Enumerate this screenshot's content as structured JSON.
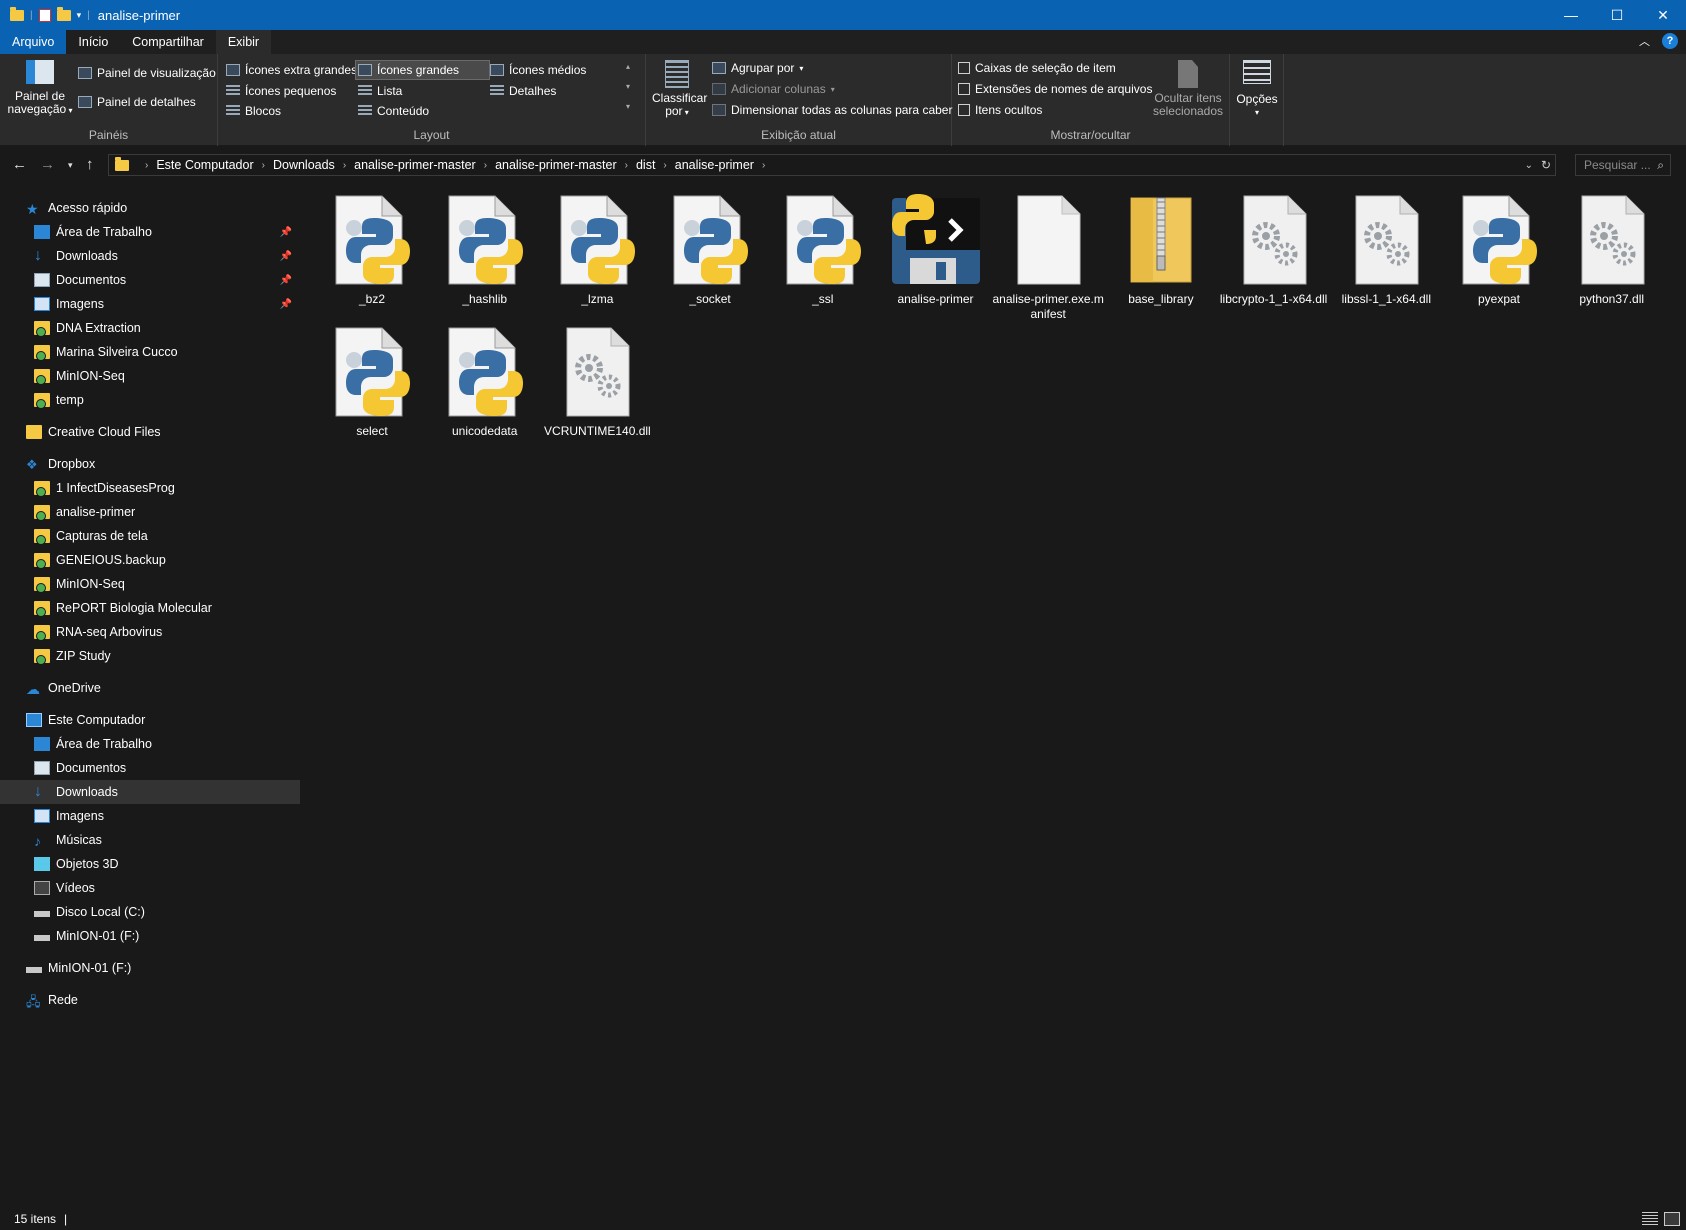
{
  "window": {
    "title": "analise-primer",
    "minimize": "—",
    "maximize": "☐",
    "close": "✕"
  },
  "menu": {
    "file": "Arquivo",
    "tabs": [
      "Início",
      "Compartilhar",
      "Exibir"
    ]
  },
  "ribbon": {
    "panes": {
      "nav_pane": "Painel de navegação",
      "preview_pane": "Painel de visualização",
      "details_pane": "Painel de detalhes",
      "label": "Painéis"
    },
    "layout": {
      "items": [
        "Ícones extra grandes",
        "Ícones grandes",
        "Ícones médios",
        "Ícones pequenos",
        "Lista",
        "Detalhes",
        "Blocos",
        "Conteúdo"
      ],
      "selected": "Ícones grandes",
      "label": "Layout"
    },
    "current_view": {
      "sort_by": "Classificar por",
      "group_by": "Agrupar por",
      "add_columns": "Adicionar colunas",
      "size_columns": "Dimensionar todas as colunas para caber",
      "label": "Exibição atual"
    },
    "show_hide": {
      "checkboxes": [
        "Caixas de seleção de item",
        "Extensões de nomes de arquivos",
        "Itens ocultos"
      ],
      "hide_selected": "Ocultar itens selecionados",
      "label": "Mostrar/ocultar"
    },
    "options": "Opções"
  },
  "address": {
    "crumbs": [
      "Este Computador",
      "Downloads",
      "analise-primer-master",
      "analise-primer-master",
      "dist",
      "analise-primer"
    ],
    "search_placeholder": "Pesquisar ..."
  },
  "sidebar": {
    "quick_access": "Acesso rápido",
    "quick_items": [
      {
        "label": "Área de Trabalho",
        "pinned": true
      },
      {
        "label": "Downloads",
        "pinned": true
      },
      {
        "label": "Documentos",
        "pinned": true
      },
      {
        "label": "Imagens",
        "pinned": true
      },
      {
        "label": "DNA Extraction",
        "pinned": false
      },
      {
        "label": "Marina Silveira Cucco",
        "pinned": false
      },
      {
        "label": "MinION-Seq",
        "pinned": false
      },
      {
        "label": "temp",
        "pinned": false
      }
    ],
    "creative_cloud": "Creative Cloud Files",
    "dropbox": "Dropbox",
    "dropbox_items": [
      "1 InfectDiseasesProg",
      "analise-primer",
      "Capturas de tela",
      "GENEIOUS.backup",
      "MinION-Seq",
      "RePORT Biologia Molecular",
      "RNA-seq Arbovirus",
      "ZIP Study"
    ],
    "onedrive": "OneDrive",
    "this_pc": "Este Computador",
    "pc_items": [
      "Área de Trabalho",
      "Documentos",
      "Downloads",
      "Imagens",
      "Músicas",
      "Objetos 3D",
      "Vídeos",
      "Disco Local (C:)",
      "MinION-01 (F:)"
    ],
    "pc_selected": "Downloads",
    "drive": "MinION-01 (F:)",
    "network": "Rede"
  },
  "files": [
    {
      "name": "_bz2",
      "type": "pyd"
    },
    {
      "name": "_hashlib",
      "type": "pyd"
    },
    {
      "name": "_lzma",
      "type": "pyd"
    },
    {
      "name": "_socket",
      "type": "pyd"
    },
    {
      "name": "_ssl",
      "type": "pyd"
    },
    {
      "name": "analise-primer",
      "type": "exe"
    },
    {
      "name": "analise-primer.exe.manifest",
      "type": "blank"
    },
    {
      "name": "base_library",
      "type": "zip"
    },
    {
      "name": "libcrypto-1_1-x64.dll",
      "type": "dll"
    },
    {
      "name": "libssl-1_1-x64.dll",
      "type": "dll"
    },
    {
      "name": "pyexpat",
      "type": "pyd"
    },
    {
      "name": "python37.dll",
      "type": "dll"
    },
    {
      "name": "select",
      "type": "pyd"
    },
    {
      "name": "unicodedata",
      "type": "pyd"
    },
    {
      "name": "VCRUNTIME140.dll",
      "type": "dll"
    }
  ],
  "status": {
    "count": "15 itens"
  },
  "colors": {
    "accent": "#0a62b3",
    "background": "#191919",
    "ribbon": "#2b2b2b"
  }
}
